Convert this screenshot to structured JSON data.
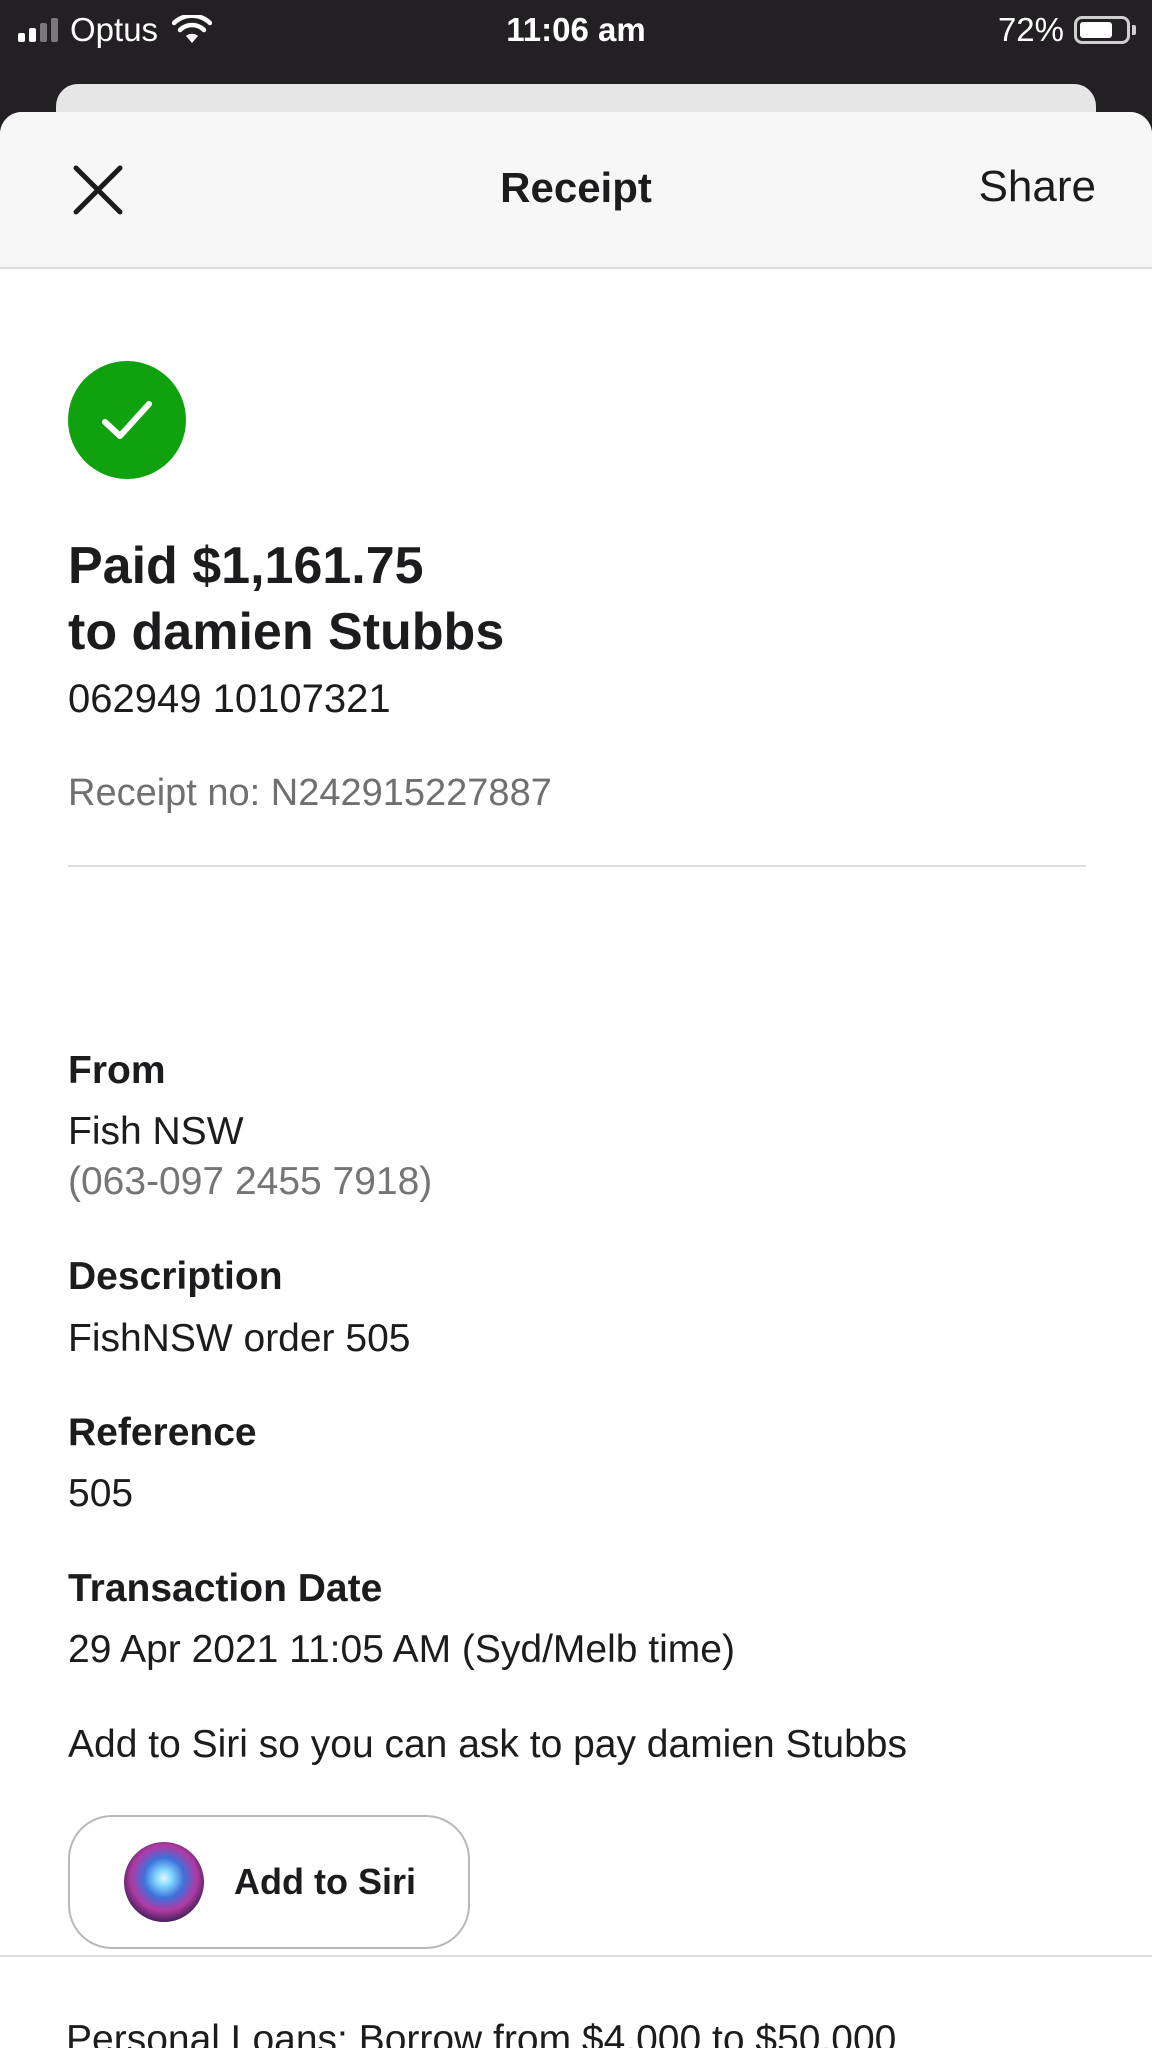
{
  "status_bar": {
    "carrier": "Optus",
    "time": "11:06 am",
    "battery_percent": "72%",
    "battery_level": 0.72,
    "signal_bars": 2,
    "icons": [
      "signal-icon",
      "wifi-icon",
      "battery-icon"
    ]
  },
  "nav": {
    "title": "Receipt",
    "share_label": "Share",
    "close_icon": "close-icon"
  },
  "receipt": {
    "status_icon": "check-circle-icon",
    "status_color": "#10a10f",
    "paid_line": "Paid $1,161.75",
    "to_line": "to damien Stubbs",
    "account": "062949 10107321",
    "receipt_no": "Receipt no: N242915227887"
  },
  "details": {
    "from_label": "From",
    "from_name": "Fish NSW",
    "from_account": "(063-097 2455 7918)",
    "description_label": "Description",
    "description_value": "FishNSW order 505",
    "reference_label": "Reference",
    "reference_value": "505",
    "date_label": "Transaction Date",
    "date_value": "29 Apr 2021 11:05 AM (Syd/Melb time)"
  },
  "siri": {
    "hint": "Add to Siri so you can ask to pay damien Stubbs",
    "button_label": "Add to Siri",
    "icon": "siri-icon"
  },
  "promo": {
    "text": "Personal Loans: Borrow from $4,000 to $50,000"
  }
}
